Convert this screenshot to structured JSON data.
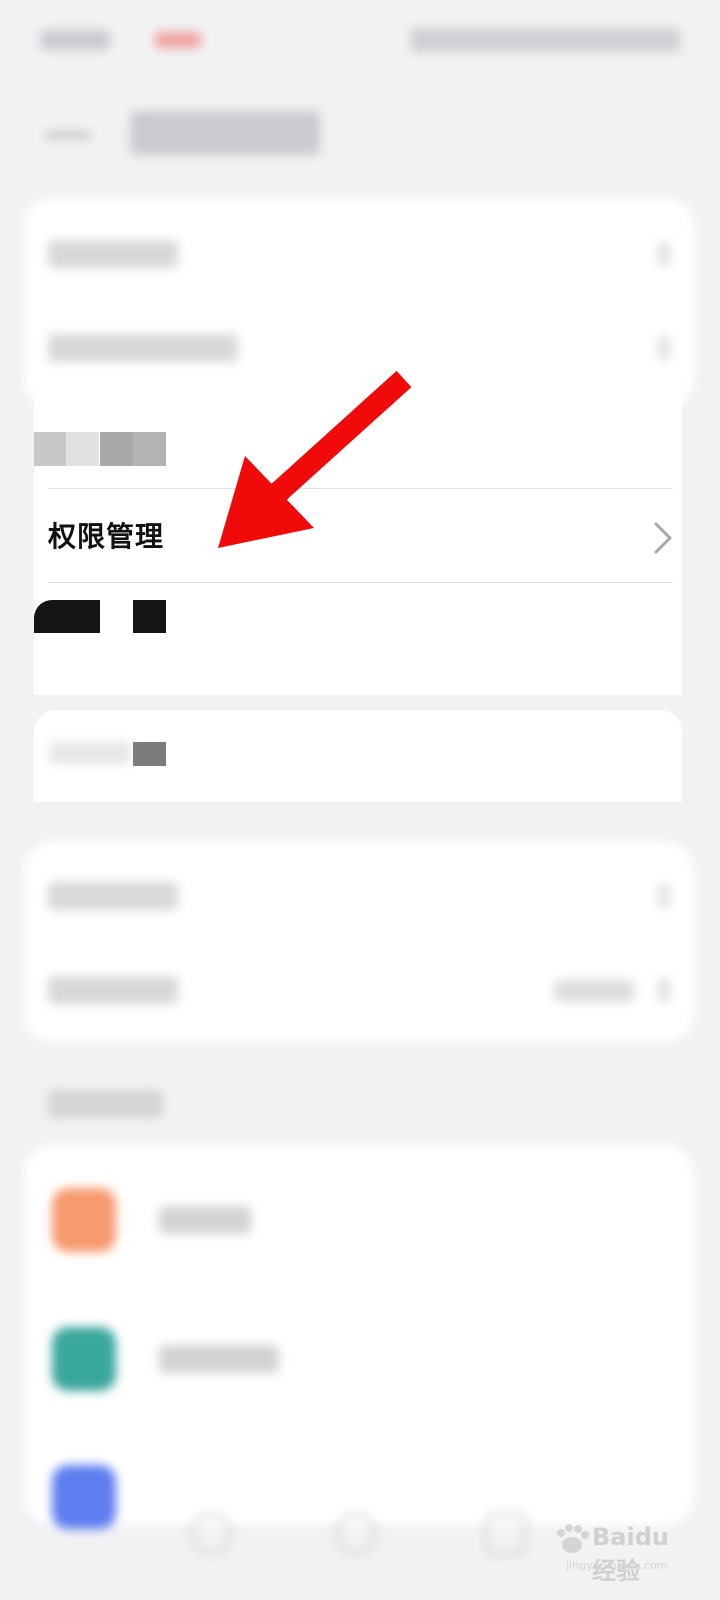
{
  "permission_row": {
    "label": "权限管理"
  },
  "annotation": {
    "arrow_color": "#f00a0a"
  },
  "watermark": {
    "brand": "Bai",
    "brand2": "du",
    "suffix": "经验",
    "url": "jingyan.baidu.com"
  },
  "icons": {
    "back": "back-arrow-icon",
    "chevron": "chevron-right-icon"
  }
}
